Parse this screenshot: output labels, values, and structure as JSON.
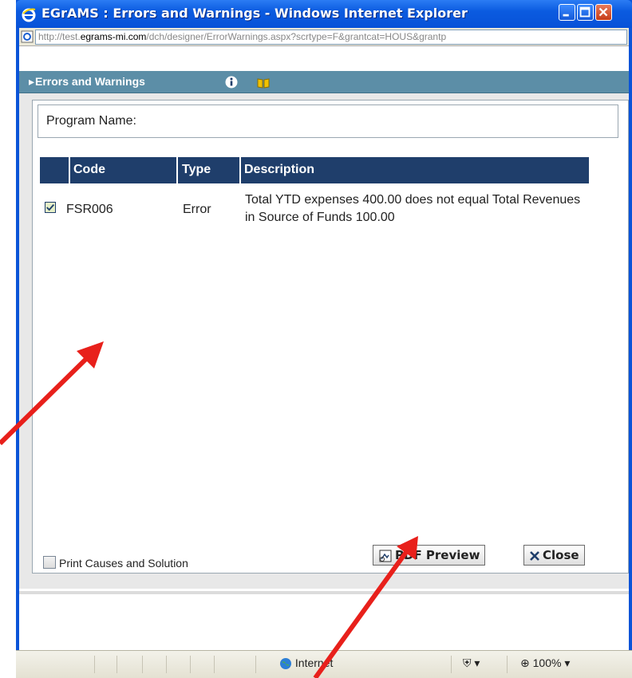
{
  "window": {
    "title": "EGrAMS : Errors and Warnings - Windows Internet Explorer"
  },
  "address_bar": {
    "scheme_prefix": "http://test.",
    "domain": "egrams-mi.com",
    "path": "/dch/designer/ErrorWarnings.aspx?scrtype=F&grantcat=HOUS&grantp"
  },
  "panel": {
    "title": "Errors and Warnings",
    "icons": [
      "info-icon",
      "book-icon"
    ]
  },
  "program": {
    "label": "Program Name:"
  },
  "grid": {
    "columns": [
      "Code",
      "Type",
      "Description"
    ],
    "rows": [
      {
        "checked": true,
        "code": "FSR006",
        "type": "Error",
        "description": "Total YTD expenses 400.00 does not equal Total Revenues in Source of Funds 100.00"
      }
    ]
  },
  "footer": {
    "print_label": "Print Causes and Solution",
    "print_checked": false,
    "pdf_button": "PDF Preview",
    "close_button": "Close"
  },
  "statusbar": {
    "zone": "Internet",
    "zoom": "100%"
  },
  "colors": {
    "titlebar": "#0b5be0",
    "panel_header": "#5c8ea7",
    "grid_header": "#1f3e6b",
    "annotation_arrows": "#e8201b"
  }
}
